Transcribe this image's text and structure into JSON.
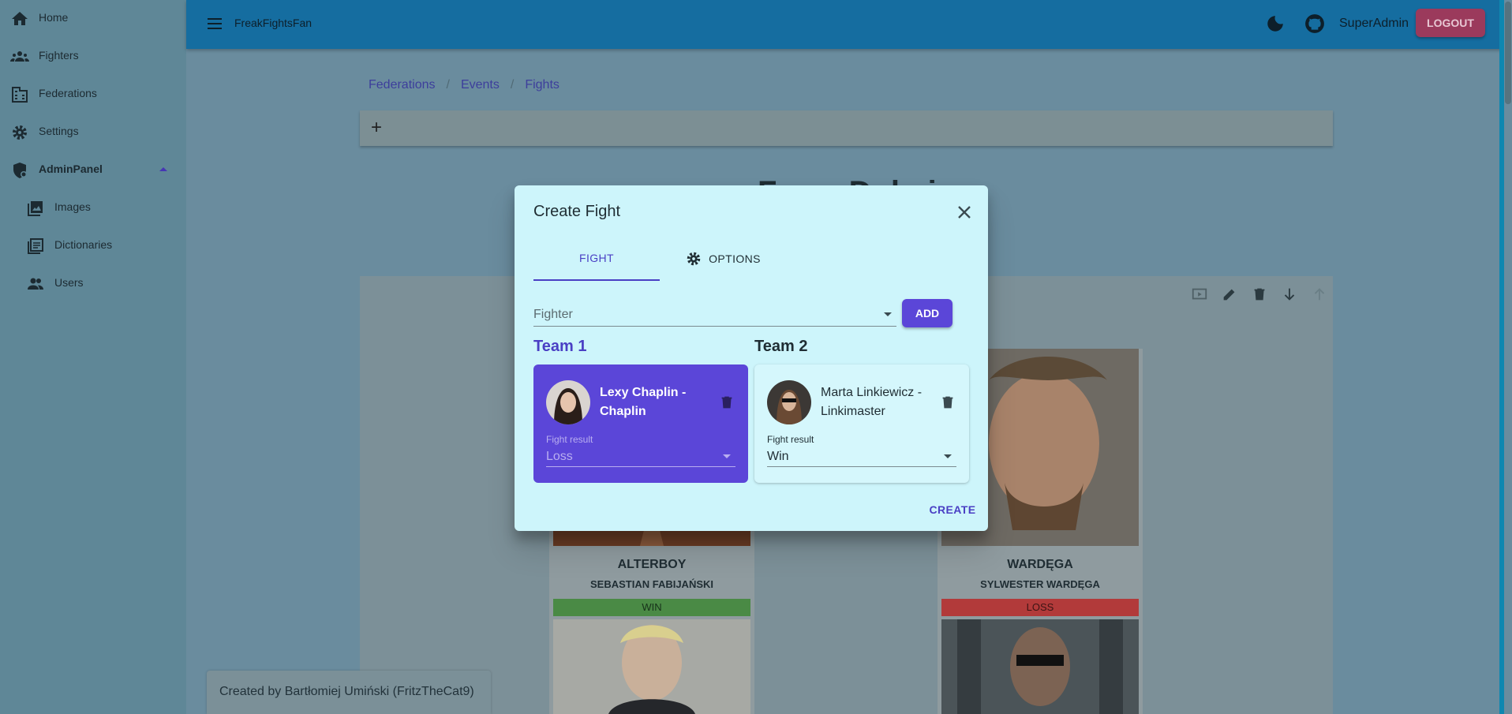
{
  "app": {
    "title": "FreakFightsFan",
    "user": "SuperAdmin",
    "logout_label": "LOGOUT"
  },
  "sidebar": {
    "items": [
      {
        "label": "Home",
        "icon": "home-icon"
      },
      {
        "label": "Fighters",
        "icon": "people-icon"
      },
      {
        "label": "Federations",
        "icon": "building-icon"
      },
      {
        "label": "Settings",
        "icon": "gear-icon"
      },
      {
        "label": "AdminPanel",
        "icon": "admin-shield-icon",
        "expanded": true
      },
      {
        "label": "Images",
        "icon": "image-icon"
      },
      {
        "label": "Dictionaries",
        "icon": "dictionary-icon"
      },
      {
        "label": "Users",
        "icon": "users-icon"
      }
    ]
  },
  "breadcrumb": [
    "Federations",
    "Events",
    "Fights"
  ],
  "toolbar": {
    "add_label": "+"
  },
  "event": {
    "title": "Fame Dubai"
  },
  "background_cards": [
    {
      "nickname": "ALTERBOY",
      "name": "SEBASTIAN FABIJAŃSKI",
      "result": "WIN",
      "result_color": "#4a8a45"
    },
    {
      "nickname": "WARDĘGA",
      "name": "SYLWESTER WARDĘGA",
      "result": "LOSS",
      "result_color": "#b23a3a"
    }
  ],
  "footer": {
    "text": "Created by Bartłomiej Umiński (FritzTheCat9)"
  },
  "dialog": {
    "title": "Create Fight",
    "tabs": [
      {
        "label": "FIGHT",
        "active": true
      },
      {
        "label": "OPTIONS",
        "icon": "gear-icon"
      }
    ],
    "fighter_placeholder": "Fighter",
    "add_label": "ADD",
    "team1": {
      "heading": "Team 1",
      "fighter": "Lexy Chaplin - Chaplin",
      "result_label": "Fight result",
      "result": "Loss"
    },
    "team2": {
      "heading": "Team 2",
      "fighter": "Marta Linkiewicz - Linkimaster",
      "result_label": "Fight result",
      "result": "Win"
    },
    "create_label": "CREATE"
  },
  "colors": {
    "primary": "#5b46d8",
    "appbar": "#156da0",
    "dialog_bg": "#cdf5fb",
    "logout": "#9b3a5c"
  }
}
